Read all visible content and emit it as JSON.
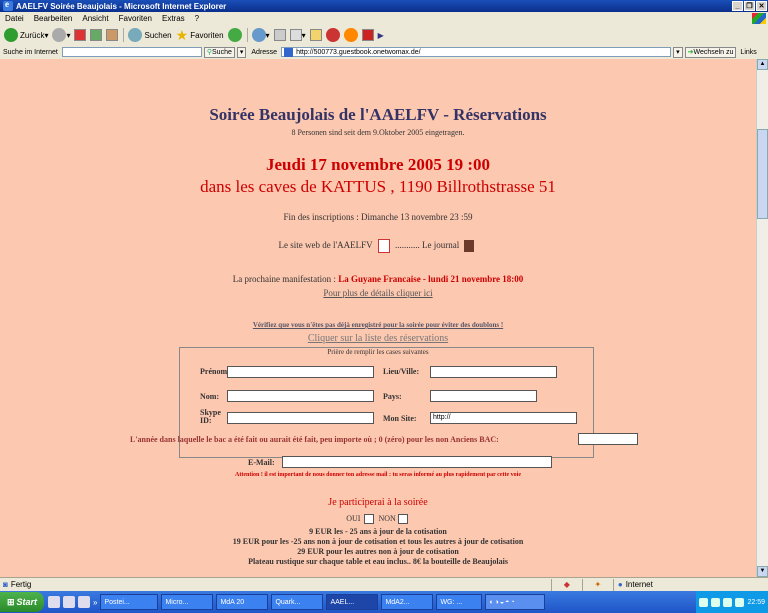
{
  "window": {
    "title": "AAELFV Soirée Beaujolais - Microsoft Internet Explorer",
    "controls": [
      "_",
      "&#9633;",
      "×"
    ]
  },
  "menu": [
    "Datei",
    "Bearbeiten",
    "Ansicht",
    "Favoriten",
    "Extras",
    "?"
  ],
  "toolbar": {
    "back": "Zurück",
    "search": "Suchen",
    "favorites": "Favoriten"
  },
  "addressbar": {
    "search_label": "Suche im Internet",
    "search_button": "Suche",
    "address_label": "Adresse",
    "url": "http://500773.guestbook.onetwomax.de/",
    "go_label": "Wechseln zu",
    "links_label": "Links"
  },
  "page": {
    "title": "Soirée Beaujolais de l'AAELFV - Réservations",
    "subtitle": "8 Personen sind seit dem 9.Oktober 2005 eingetragen.",
    "date_line": "Jeudi 17 novembre 2005 19 :00",
    "place_line": "dans les caves de KATTUS , 1190 Billrothstrasse 51",
    "deadline": "Fin des inscriptions : Dimanche 13 novembre 23 :59",
    "site_label": "Le site web de l'AAELFV",
    "dots": "...........",
    "journal_label": "Le journal",
    "next_event_label": "La prochaine manifestation : ",
    "next_event": "La Guyane Francaise - lundi 21 novembre 18:00",
    "more_details": "Pour plus de détails cliquer ici",
    "verify": "Vérifiez que vous n'êtes pas déjà enregistré pour la soirée pour éviter des doublons !",
    "list_link": "Cliquer sur la liste des réservations",
    "fill_prompt": "Prière de remplir les cases suivantes",
    "form": {
      "prenom_label": "Prénom:",
      "lieu_label": "Lieu/Ville:",
      "nom_label": "Nom:",
      "pays_label": "Pays:",
      "skype_label": "Skype ID:",
      "site_label": "Mon Site:",
      "site_value": "http://",
      "bac_label": "L'année dans laquelle le bac a été fait ou aurait été fait, peu importe où ; 0 (zéro) pour les non Anciens BAC:",
      "email_label": "E-Mail:"
    },
    "attention": "Attention ! il est important de nous donner ton adresse mail : tu seras informé au plus rapidement par cette voie",
    "participate": "Je participerai à la soirée",
    "oui": "OUI",
    "non": "NON",
    "prices": [
      "9 EUR les - 25 ans à jour de la cotisation",
      "19 EUR pour les -25 ans non à jour de cotisation et tous les autres à jour de cotisation",
      "29 EUR pour les autres non à jour de cotisation",
      "Plateau rustique sur chaque table et eau inclus.. 8€ la bouteille de Beaujolais"
    ]
  },
  "status": {
    "text": "Fertig",
    "zone": "Internet"
  },
  "taskbar": {
    "start": "Start",
    "tasks": [
      "Postei...",
      "Micro...",
      "MdA 20",
      "Quark...",
      "AAEL...",
      "MdA2...",
      "WG: ..."
    ],
    "active_task": "AAEL...",
    "clock": "22:59"
  }
}
